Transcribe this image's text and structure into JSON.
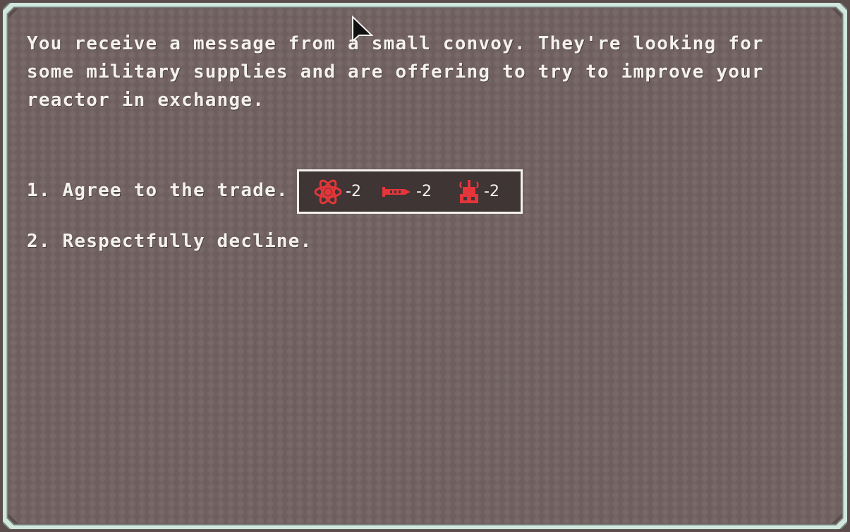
{
  "event": {
    "text": "You receive a message from a small convoy. They're looking for some military supplies and are offering to try to improve your reactor in exchange."
  },
  "choices": [
    {
      "label": "1. Agree to the trade.",
      "costs": [
        {
          "icon": "fuel-icon",
          "value": "-2"
        },
        {
          "icon": "missile-icon",
          "value": "-2"
        },
        {
          "icon": "drone-parts-icon",
          "value": "-2"
        }
      ]
    },
    {
      "label": "2. Respectfully decline."
    }
  ],
  "colors": {
    "frame": "#dfe9e3",
    "panel": "#746463",
    "text": "#f4f1ee",
    "cost_icon": "#e4363a",
    "cost_box_bg": "#3e3534"
  }
}
